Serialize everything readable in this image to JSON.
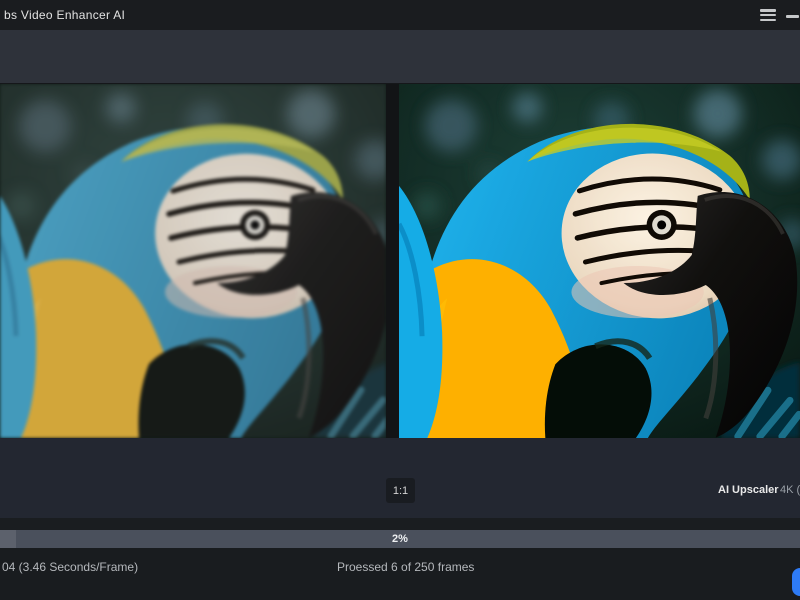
{
  "window": {
    "title": "bs Video Enhancer AI"
  },
  "viewer": {
    "zoom_ratio": "1:1",
    "model_name": "AI Upscaler",
    "output_resolution": "4K (",
    "comparison": [
      "original",
      "enhanced"
    ]
  },
  "progress": {
    "label": "2%",
    "percent": 2,
    "fill_style": "width:2%"
  },
  "status": {
    "time_per_frame": "04 (3.46 Seconds/Frame)",
    "frames_processed": "Proessed 6 of 250 frames"
  },
  "icons": {
    "menu": "menu-icon",
    "minimize": "minimize-icon"
  },
  "colors": {
    "accent_blue": "#2e7bf6",
    "progress_track": "#4a505c",
    "titlebar_bg": "#1a1c1f",
    "toolbar_bg": "#2e323a",
    "panel_bg": "#232731"
  }
}
